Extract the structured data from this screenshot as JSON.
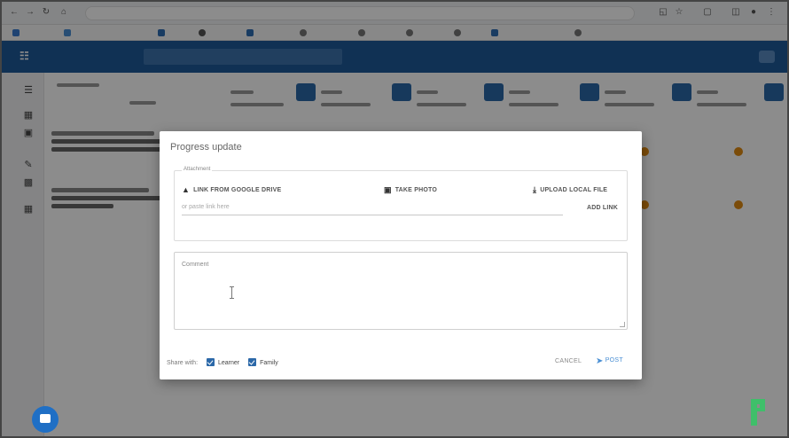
{
  "dialog": {
    "title": "Progress update",
    "attachments_legend": "Attachment",
    "link_from_drive_label": "LINK FROM GOOGLE DRIVE",
    "take_photo_label": "TAKE PHOTO",
    "upload_local_label": "UPLOAD LOCAL FILE",
    "link_placeholder": "or paste link here",
    "add_link_label": "ADD LINK",
    "comment_label": "Comment",
    "share_with_label": "Share with:",
    "share_options": [
      {
        "label": "Learner",
        "checked": true
      },
      {
        "label": "Family",
        "checked": true
      }
    ],
    "cancel_label": "CANCEL",
    "post_label": "POST"
  },
  "colors": {
    "header_blue": "#1e5a9a",
    "accent_blue": "#2b68a8",
    "link_blue": "#4a8fd4",
    "warning_orange": "#e08a12",
    "chat_fab": "#1f6fc5",
    "brand_green": "#3fbf6a"
  },
  "icons": {
    "drive": "google-drive-icon",
    "camera": "camera-icon",
    "upload": "upload-icon",
    "send": "send-icon",
    "chat": "chat-bubble-icon"
  }
}
